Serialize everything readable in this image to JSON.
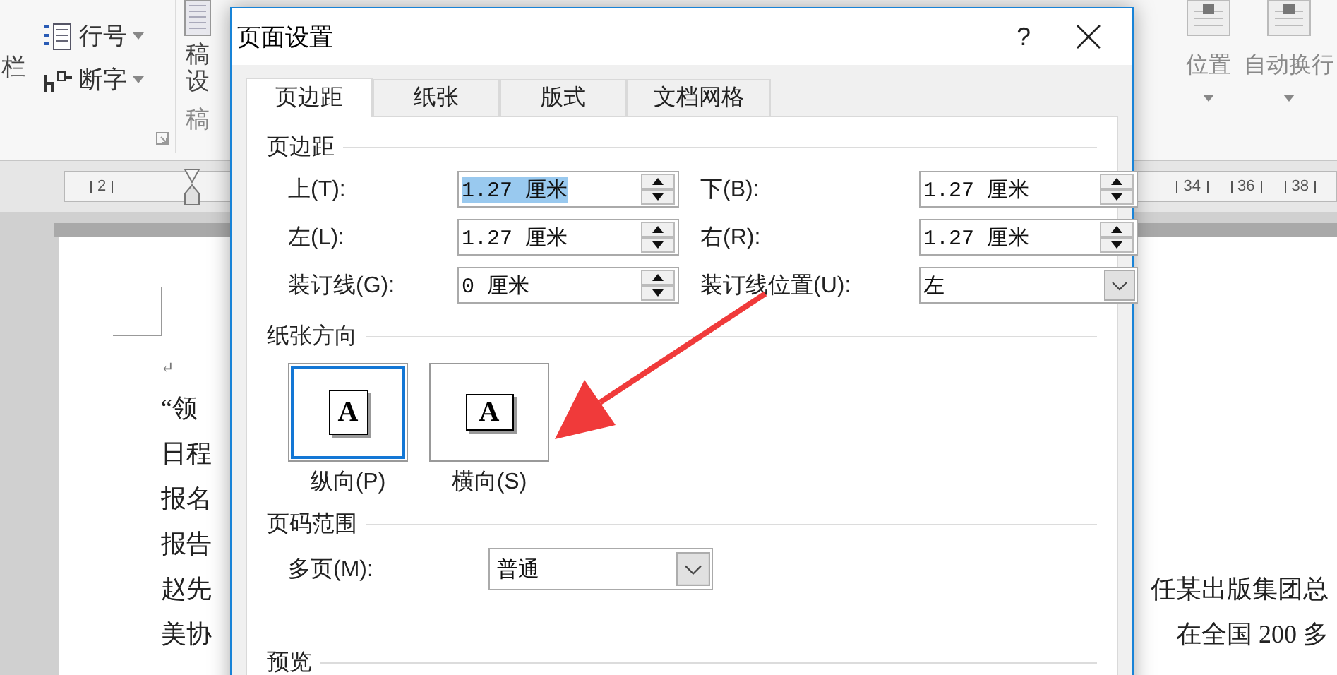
{
  "ribbon": {
    "cut_buttons": [
      {
        "label": "栏"
      }
    ],
    "small_buttons": [
      {
        "label": "行号"
      },
      {
        "label": "断字"
      }
    ],
    "tall_button": {
      "label": "稿设"
    },
    "group_label": "稿",
    "right_buttons": [
      {
        "label": "位置"
      },
      {
        "label": "自动换行"
      }
    ]
  },
  "ruler": {
    "left_marks": [
      "2"
    ],
    "right_marks": [
      "34",
      "36",
      "38"
    ]
  },
  "document": {
    "paragraph_mark": "↵",
    "lines": [
      {
        "start": "“领"
      },
      {
        "start": "日程"
      },
      {
        "start": "报名"
      },
      {
        "start": "报告"
      },
      {
        "start": "赵先",
        "end": "任某出版集团总"
      },
      {
        "start": "美协",
        "end": "在全国 200 多"
      }
    ]
  },
  "dialog": {
    "title": "页面设置",
    "help": "?",
    "tabs": [
      {
        "label": "页边距",
        "selected": true
      },
      {
        "label": "纸张",
        "selected": false
      },
      {
        "label": "版式",
        "selected": false
      },
      {
        "label": "文档网格",
        "selected": false
      }
    ],
    "margins": {
      "heading": "页边距",
      "fields": [
        {
          "label": "上(T):",
          "value": "1.27 厘米",
          "kind": "spin",
          "text_selected": true
        },
        {
          "label": "下(B):",
          "value": "1.27 厘米",
          "kind": "spin",
          "text_selected": false
        },
        {
          "label": "左(L):",
          "value": "1.27 厘米",
          "kind": "spin",
          "text_selected": false
        },
        {
          "label": "右(R):",
          "value": "1.27 厘米",
          "kind": "spin",
          "text_selected": false
        },
        {
          "label": "装订线(G):",
          "value": "0 厘米",
          "kind": "spin",
          "text_selected": false
        },
        {
          "label": "装订线位置(U):",
          "value": "左",
          "kind": "dropdown",
          "text_selected": false
        }
      ]
    },
    "orientation": {
      "heading": "纸张方向",
      "options": [
        {
          "label": "纵向(P)",
          "glyph": "A",
          "kind": "portrait",
          "selected": true
        },
        {
          "label": "横向(S)",
          "glyph": "A",
          "kind": "landscape",
          "selected": false
        }
      ]
    },
    "pages": {
      "heading": "页码范围",
      "label": "多页(M):",
      "value": "普通"
    },
    "preview": {
      "heading": "预览"
    }
  }
}
